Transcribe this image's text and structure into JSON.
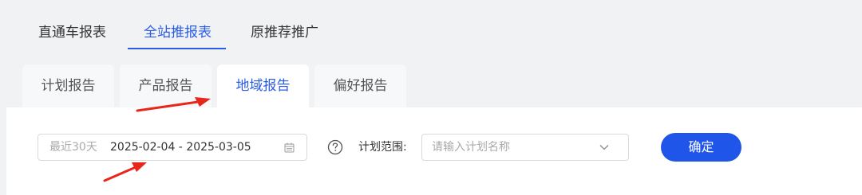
{
  "main_tabs": [
    {
      "label": "直通车报表",
      "active": false
    },
    {
      "label": "全站推报表",
      "active": true
    },
    {
      "label": "原推荐推广",
      "active": false
    }
  ],
  "sub_tabs": [
    {
      "label": "计划报告",
      "active": false
    },
    {
      "label": "产品报告",
      "active": false
    },
    {
      "label": "地域报告",
      "active": true
    },
    {
      "label": "偏好报告",
      "active": false
    }
  ],
  "filter": {
    "date_prefix": "最近30天",
    "date_range": "2025-02-04 - 2025-03-05",
    "range_label": "计划范围:",
    "plan_placeholder": "请输入计划名称",
    "confirm_label": "确定"
  },
  "colors": {
    "accent": "#2b5ce6",
    "button": "#1f55e8",
    "annotation_arrow": "#e8261a"
  }
}
